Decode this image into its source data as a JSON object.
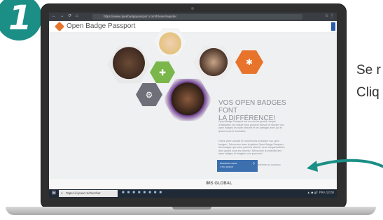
{
  "step": {
    "number": "1",
    "color": "#1b8e86"
  },
  "browser": {
    "nav_icons": "← → ⟳ ⌂",
    "url": "https://www.openbadgepassport.com/fr/user/register",
    "right_icons": "☆ ⋮"
  },
  "site": {
    "logo_text": "Open Badge Passport",
    "brand_color": "#e8732b",
    "headline_1": "VOS OPEN BADGES FONT",
    "headline_2": "LA DIFFÉRENCE!",
    "paragraph_1": "Open Badge Passport est un service gratuit, simple d'utilisation, sur lequel vous pouvez recevoir et stocker vos open badges en toute sécurité et les partager avec qui et quand vous le souhaitez.",
    "paragraph_2": "Créez votre compte et commencez à stocker vos open badges ! Découvrez dans la galerie Open Badge Passport des badges que vous pourriez obtenir, ceux d'organisations dont quand vous les recevez. Découvrez le potentiel des open badges et imaginez vos parcours!",
    "paragraph_3": "Open Badge Passport est certifié conforme au nouveau standard de IMS Global.",
    "cta_label": "Inscrivez-vous",
    "cta_sub": "c'est gratuit",
    "cta_color": "#3b6fae",
    "footer_logo": "IMS GLOBAL"
  },
  "taskbar": {
    "search_placeholder": "Taper ici pour rechercher",
    "tray": "▲ ◆ 🔊 FRA 12:00"
  },
  "side_text": {
    "line_1": "Se r",
    "line_2": "Cliq"
  },
  "icons": [
    "step-badge",
    "browser-nav-icons",
    "logo-icon",
    "badge-icons",
    "arrow-right-icon",
    "windows-icon",
    "search-icon",
    "curved-arrow-icon"
  ]
}
